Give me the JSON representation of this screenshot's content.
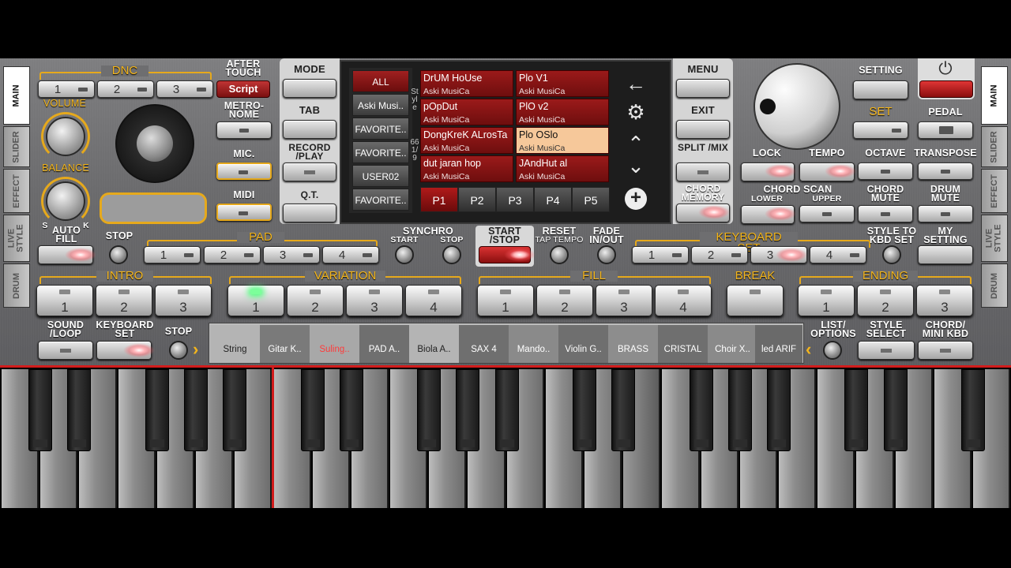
{
  "side_tabs_left": [
    "MAIN",
    "SLIDER",
    "EFFECT",
    "LIVE STYLE",
    "DRUM"
  ],
  "side_tabs_right": [
    "MAIN",
    "SLIDER",
    "EFFECT",
    "LIVE STYLE",
    "DRUM"
  ],
  "top_left": {
    "dnc": "DNC",
    "after_touch": "AFTER TOUCH",
    "dnc_buttons": [
      "1",
      "2",
      "3"
    ],
    "script": "Script",
    "volume": "VOLUME",
    "balance": "BALANCE",
    "bal_s": "S",
    "bal_k": "K",
    "metronome": "METRO- NOME",
    "mic": "MIC.",
    "midi": "MIDI"
  },
  "mid_buttons": {
    "mode": "MODE",
    "tab": "TAB",
    "record": "RECORD /PLAY",
    "qt": "Q.T.",
    "menu": "MENU",
    "exit": "EXIT",
    "split": "SPLIT /MIX",
    "chord_memory": "CHORD MEMORY"
  },
  "screen": {
    "categories": [
      "ALL",
      "Aski Musi..",
      "FAVORITE..",
      "FAVORITE..",
      "USER02",
      "FAVORITE.."
    ],
    "vertical_label": "Style",
    "counter": "66 1/9",
    "styles": [
      {
        "name": "DrUM HoUse",
        "author": "Aski MusiCa"
      },
      {
        "name": "Plo V1",
        "author": "Aski MusiCa"
      },
      {
        "name": "pOpDut",
        "author": "Aski MusiCa"
      },
      {
        "name": "PlO v2",
        "author": "Aski MusiCa"
      },
      {
        "name": "DongKreK ALrosTa",
        "author": "Aski MusiCa"
      },
      {
        "name": "Plo OSlo",
        "author": "Aski MusiCa"
      },
      {
        "name": "dut jaran hop",
        "author": "Aski MusiCa"
      },
      {
        "name": "JAndHut al",
        "author": "Aski MusiCa"
      }
    ],
    "pages": [
      "P1",
      "P2",
      "P3",
      "P4",
      "P5"
    ],
    "nav": {
      "back": "←",
      "settings": "⚙",
      "up": "⌃",
      "down": "⌄",
      "add": "+"
    }
  },
  "top_right": {
    "setting": "SETTING",
    "set": "SET",
    "pedal": "PEDAL",
    "lock": "LOCK",
    "tempo": "TEMPO",
    "octave": "OCTAVE",
    "transpose": "TRANSPOSE",
    "chord_scan": "CHORD SCAN",
    "lower": "LOWER",
    "upper": "UPPER",
    "chord_mute": "CHORD MUTE",
    "drum_mute": "DRUM MUTE"
  },
  "row_pads": {
    "auto_fill": "AUTO FILL",
    "stop": "STOP",
    "pad": "PAD",
    "pad_buttons": [
      "1",
      "2",
      "3",
      "4"
    ],
    "synchro": "SYNCHRO",
    "sync_start": "START",
    "sync_stop": "STOP",
    "start_stop": "START /STOP",
    "reset": "RESET",
    "tap_tempo": "TAP TEMPO",
    "fade": "FADE IN/OUT",
    "keyboard_set": "KEYBOARD SET",
    "kbd_buttons": [
      "1",
      "2",
      "3",
      "4"
    ],
    "style_to_kbd": "STYLE TO KBD SET",
    "my_setting": "MY SETTING"
  },
  "sections": {
    "intro": "INTRO",
    "intro_buttons": [
      "1",
      "2",
      "3"
    ],
    "variation": "VARIATION",
    "variation_buttons": [
      "1",
      "2",
      "3",
      "4"
    ],
    "fill": "FILL",
    "fill_buttons": [
      "1",
      "2",
      "3",
      "4"
    ],
    "break": "BREAK",
    "ending": "ENDING",
    "ending_buttons": [
      "1",
      "2",
      "3"
    ]
  },
  "bottom_row": {
    "sound_loop": "SOUND /LOOP",
    "keyboard_set": "KEYBOARD SET",
    "stop": "STOP",
    "list_options": "LIST/ OPTIONS",
    "style_select": "STYLE SELECT",
    "chord_mini": "CHORD/ MINI KBD"
  },
  "sounds": [
    "String",
    "Gitar K..",
    "Suling..",
    "PAD A..",
    "Biola A..",
    "SAX 4",
    "Mando..",
    "Violin G..",
    "BRASS",
    "CRISTAL",
    "Choir X..",
    "led ARIF"
  ],
  "colors": {
    "accent": "#f3b51c",
    "red": "#b01a1a",
    "selected_sound": "#ff5a5a"
  }
}
